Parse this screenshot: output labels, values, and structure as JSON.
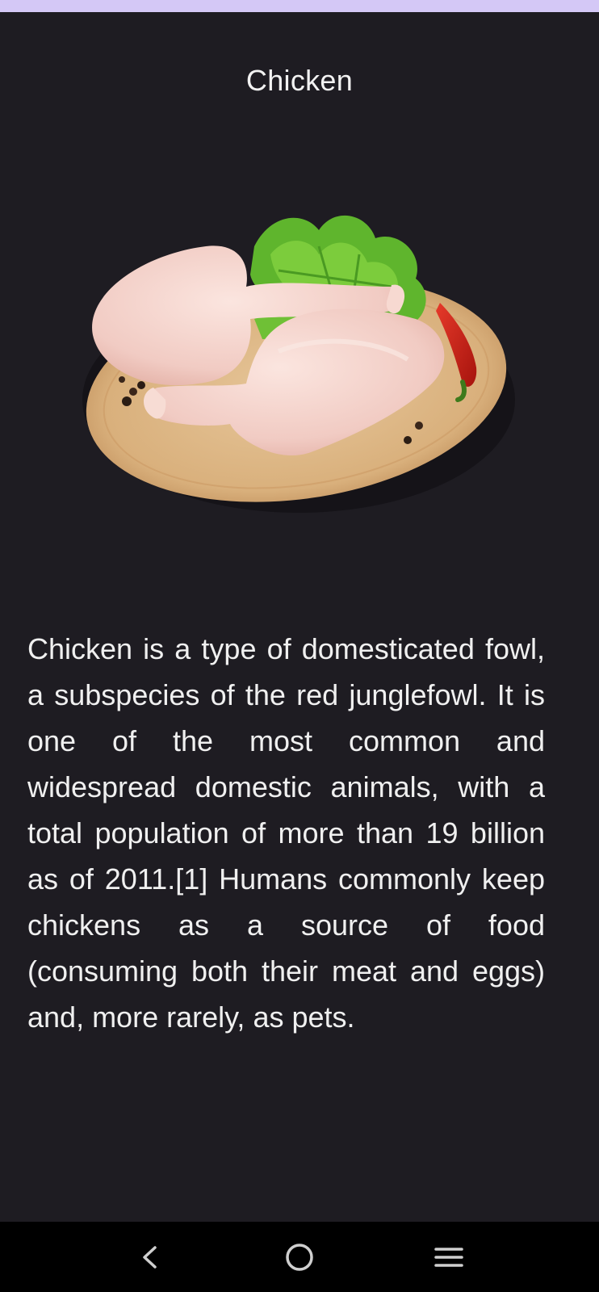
{
  "header": {
    "title": "Chicken"
  },
  "hero_image": {
    "icon": "raw-chicken-legs-on-wooden-board-image"
  },
  "content": {
    "description": "Chicken is a type of domesticated fowl, a subspecies of the red junglefowl. It is one of the most common and widespread domestic animals, with a total population of more than 19 billion as of 2011.[1] Humans commonly keep chickens as a source of food (consuming both their meat and eggs) and, more rarely, as pets."
  },
  "navigation_bar": {
    "back_icon": "chevron-left-icon",
    "home_icon": "circle-home-icon",
    "recents_icon": "three-lines-recents-icon"
  },
  "colors": {
    "status_strip": "#d4c8f6",
    "background": "#1e1c22",
    "nav_bar": "#000000",
    "text": "#f0f0f0"
  }
}
